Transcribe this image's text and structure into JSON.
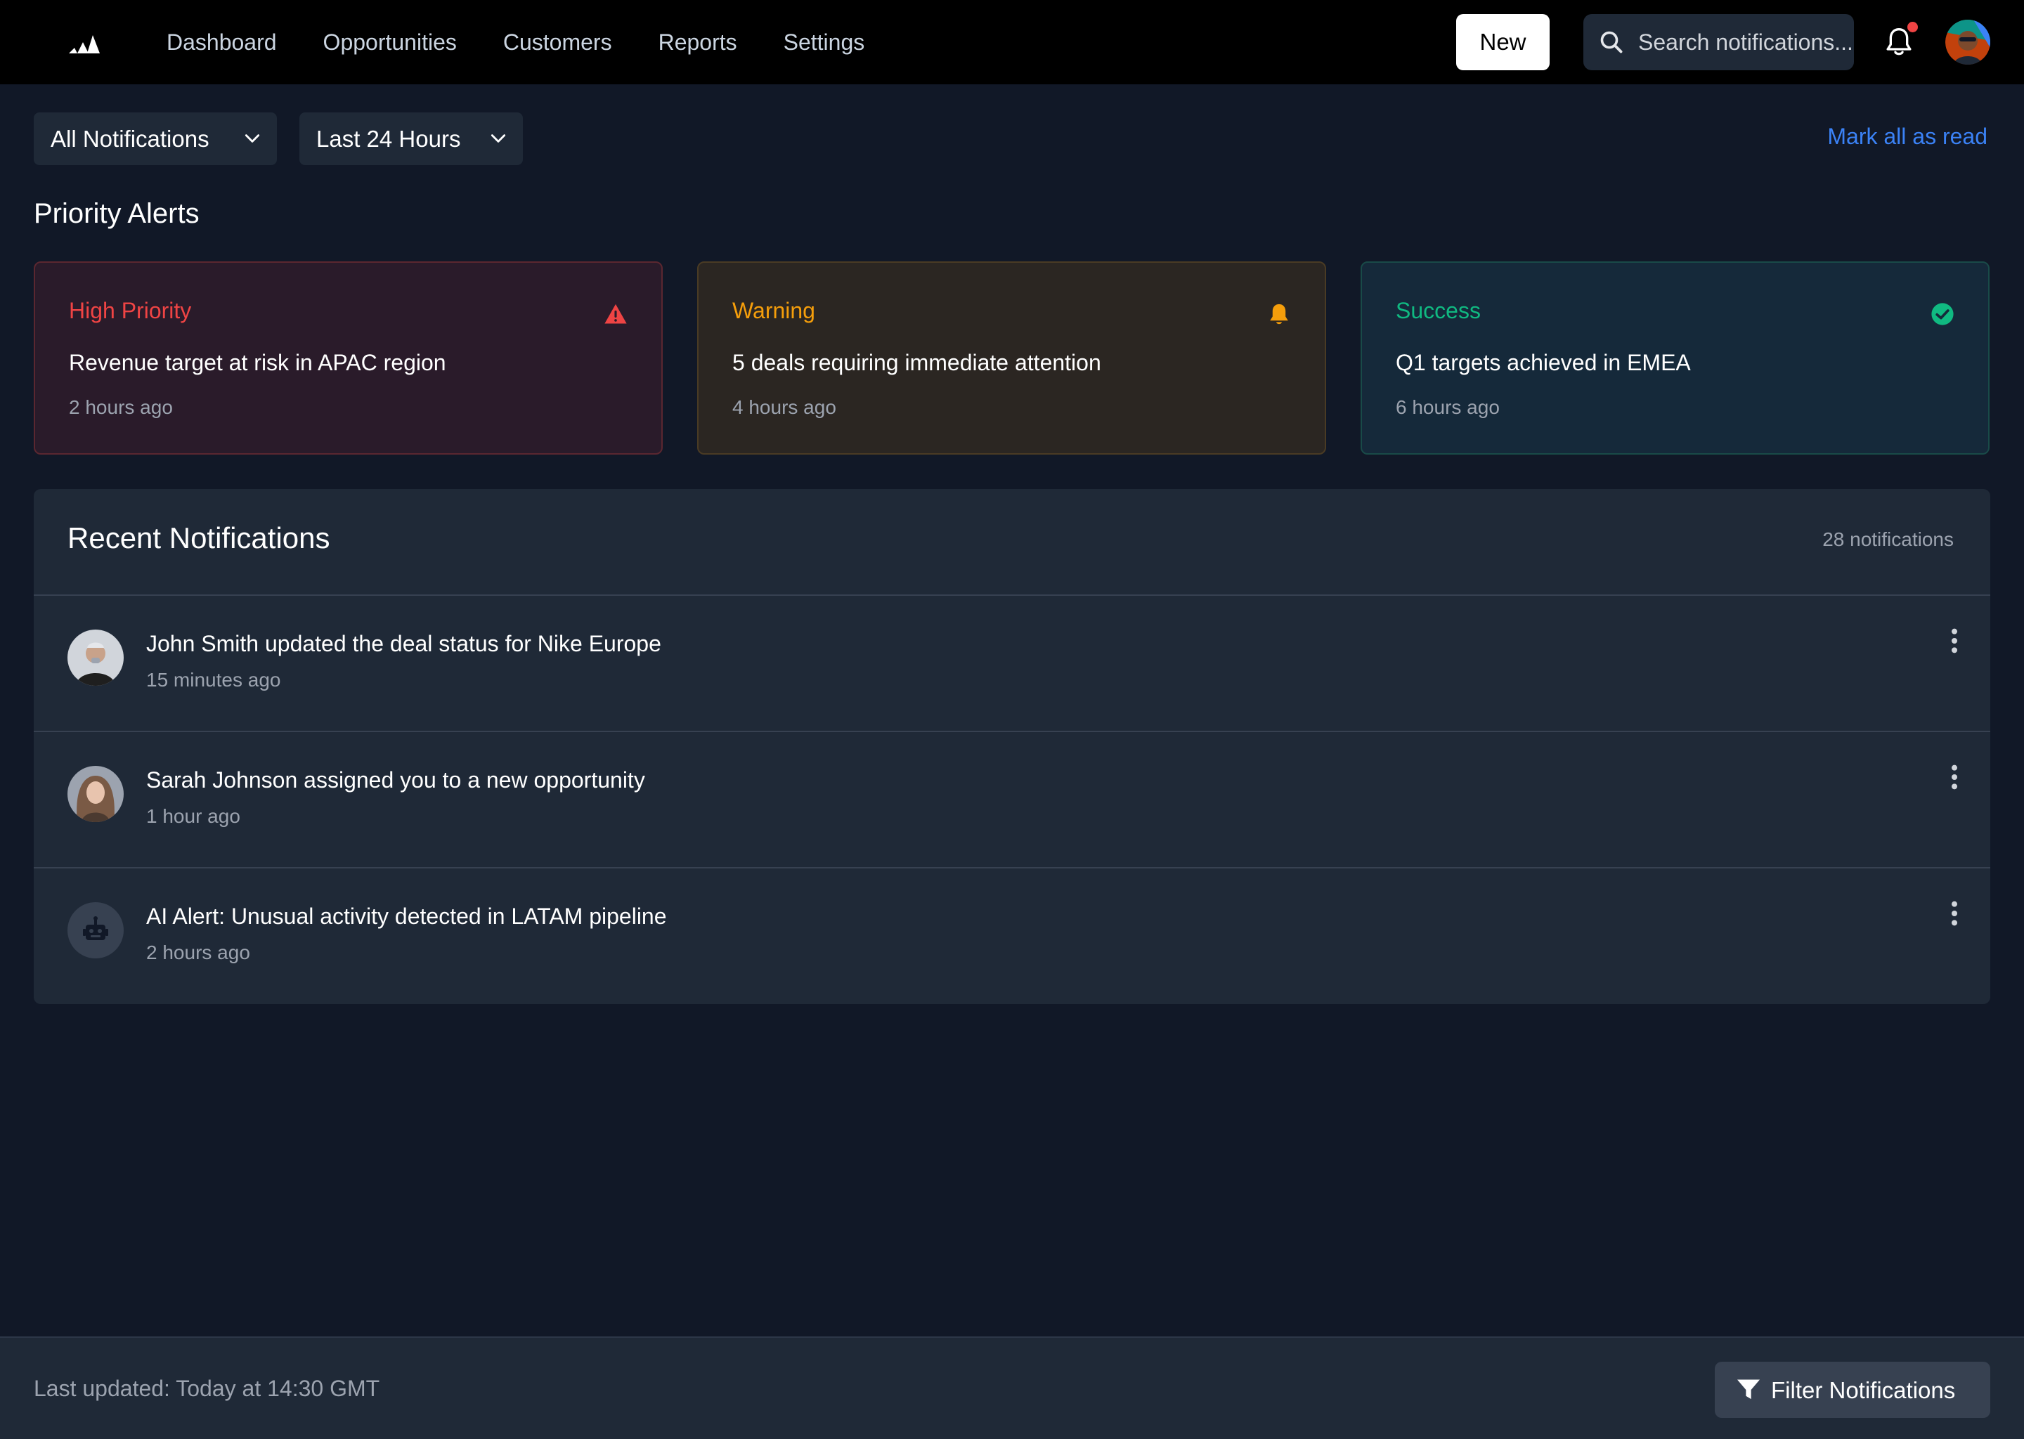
{
  "header": {
    "logo": "adidas-logo",
    "nav": [
      "Dashboard",
      "Opportunities",
      "Customers",
      "Reports",
      "Settings"
    ],
    "new_label": "New",
    "search_placeholder": "Search notifications...",
    "has_unread": true
  },
  "filters": {
    "type": "All Notifications",
    "range": "Last 24 Hours",
    "mark_all_read": "Mark all as read"
  },
  "priority": {
    "title": "Priority Alerts",
    "cards": [
      {
        "label": "High Priority",
        "title": "Revenue target at risk in APAC region",
        "time": "2 hours ago",
        "icon": "warning-triangle-icon",
        "color": "#ef4444"
      },
      {
        "label": "Warning",
        "title": "5 deals requiring immediate attention",
        "time": "4 hours ago",
        "icon": "bell-icon",
        "color": "#f59e0b"
      },
      {
        "label": "Success",
        "title": "Q1 targets achieved in EMEA",
        "time": "6 hours ago",
        "icon": "check-circle-icon",
        "color": "#10b981"
      }
    ]
  },
  "recent": {
    "title": "Recent Notifications",
    "count": "28 notifications",
    "items": [
      {
        "text": "John Smith updated the deal status for Nike Europe",
        "time": "15 minutes ago",
        "avatar": "person-avatar"
      },
      {
        "text": "Sarah Johnson assigned you to a new opportunity",
        "time": "1 hour ago",
        "avatar": "person-avatar"
      },
      {
        "text": "AI Alert: Unusual activity detected in LATAM pipeline",
        "time": "2 hours ago",
        "avatar": "robot-icon"
      }
    ]
  },
  "footer": {
    "updated": "Last updated: Today at 14:30 GMT",
    "filter_label": "Filter Notifications"
  }
}
